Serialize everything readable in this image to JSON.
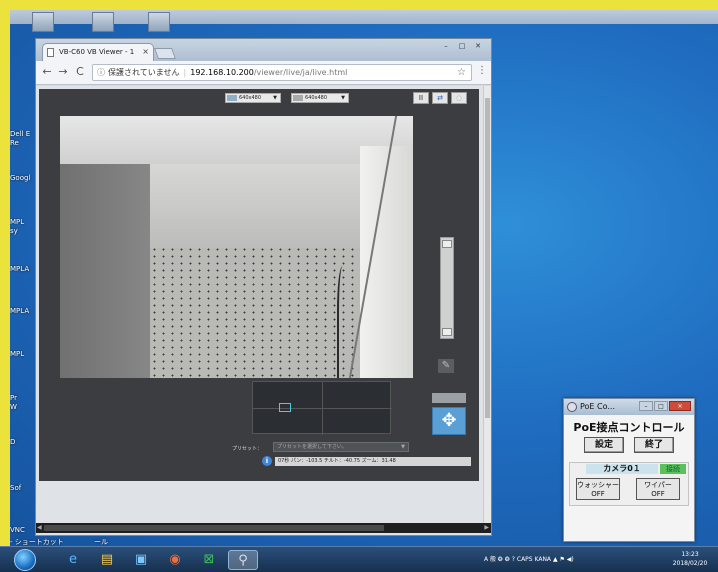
{
  "desktop": {
    "labels": [
      "Dell E\nRe",
      "Googl",
      "MPL\nsy",
      "MPLA",
      "MPLA",
      "MPL",
      "Pr\nW",
      "D",
      "Sof",
      "VNC"
    ],
    "bottom_left_text": "- ショートカット",
    "bottom_left_text2": "ール"
  },
  "browser": {
    "tab_title": "VB-C60 VB Viewer - 1",
    "tab_close": "×",
    "win_min": "–",
    "win_max": "□",
    "win_close": "✕",
    "nav_back": "←",
    "nav_forward": "→",
    "nav_reload": "C",
    "security_text": "保護されていません",
    "url_host": "192.168.10.200",
    "url_path": "/viewer/live/ja/live.html"
  },
  "viewer": {
    "size_select_1": "640x480",
    "size_select_2": "640x480",
    "pause_label": "II",
    "swap_label": "⇄",
    "preset_label": "プリセット：",
    "preset_placeholder": "プリセットを選択して下さい。",
    "status_text": "07秒 パン：-103.5 チルト：-40.75 ズーム：31.48"
  },
  "poe": {
    "window_title": "PoE Co...",
    "heading": "PoE接点コントロール",
    "settings_button": "設定",
    "exit_button": "終了",
    "camera_label": "カメラ0１",
    "connection_status": "接続",
    "washer_label": "ウォッシャー\nOFF",
    "wiper_label": "ワイパー\nOFF"
  },
  "taskbar": {
    "tray_text": "A 般 ❂ ❂ ? CAPS KANA ▲ ⚑ ◀)",
    "time": "13:23",
    "date": "2018/02/20"
  },
  "colors": {
    "frame_yellow": "#ebe33c",
    "desktop_blue": "#1f6cc0",
    "accent_cyan": "#3fd0e6",
    "connected_green": "#5cc15c"
  }
}
